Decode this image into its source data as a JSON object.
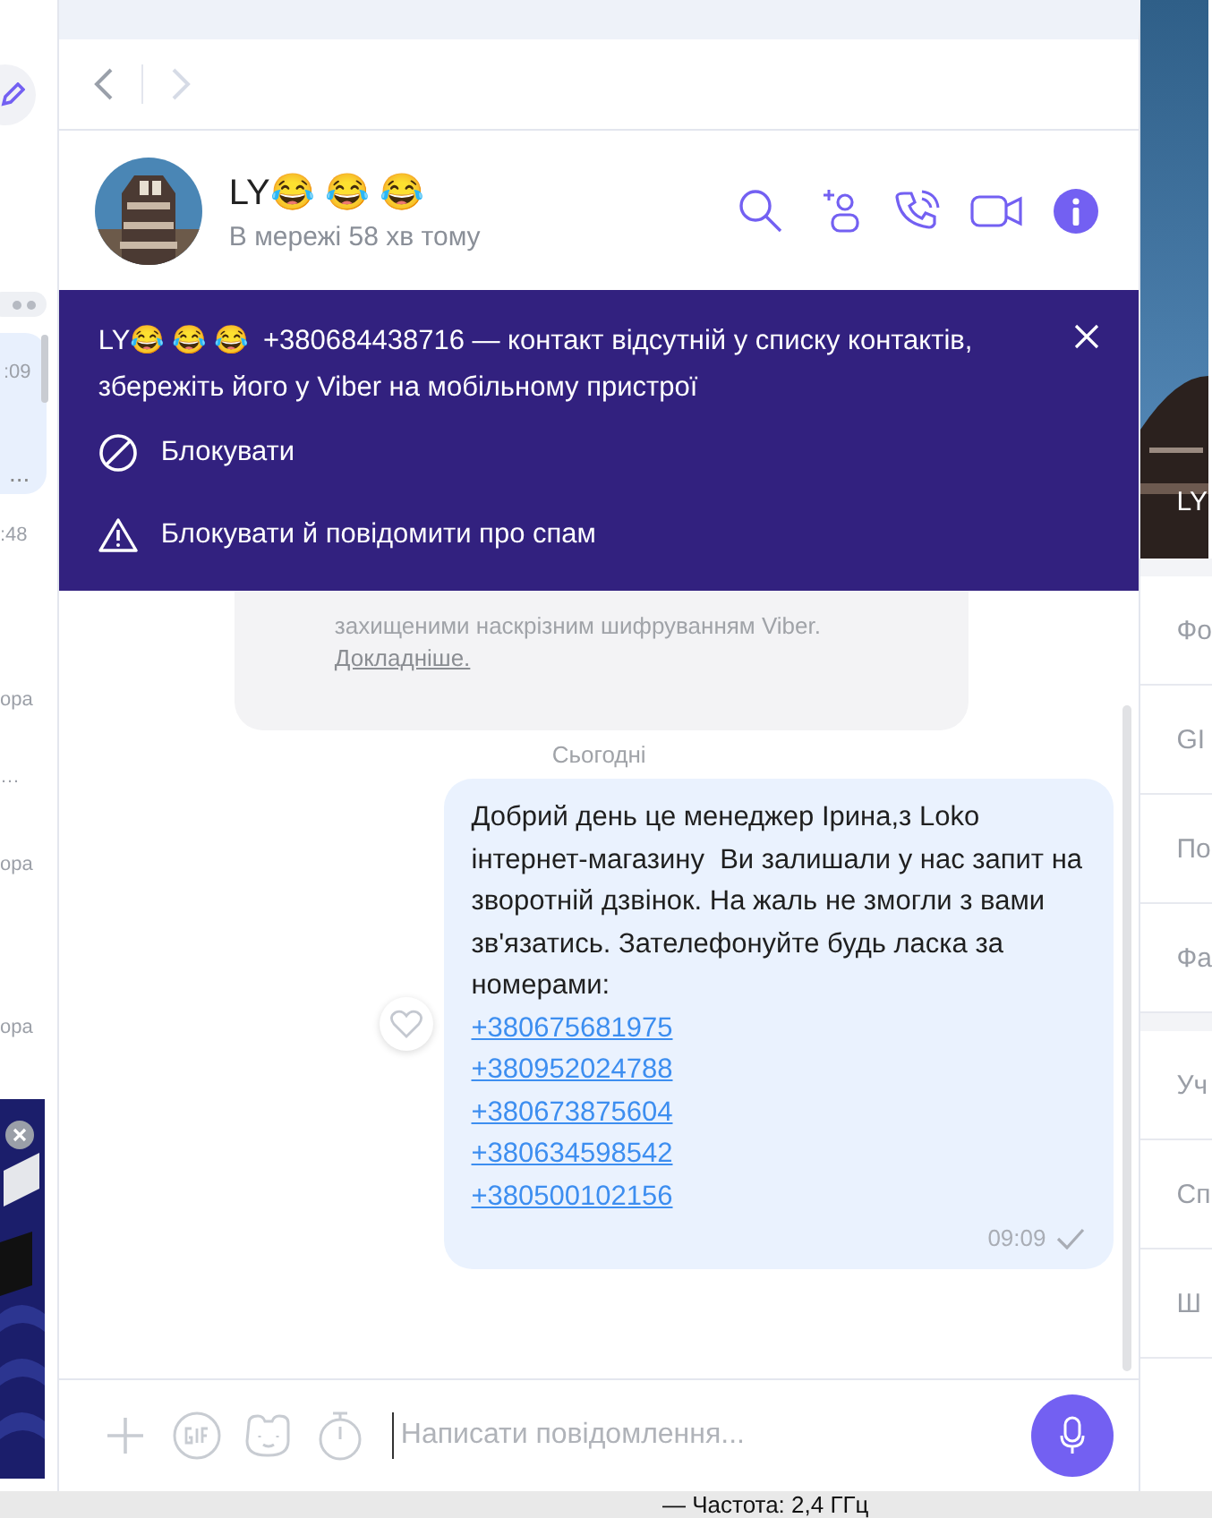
{
  "sidebar": {
    "chat": {
      "time": ":09",
      "preview": "...",
      "selected": true
    },
    "fragments": [
      ":48",
      "ора",
      "…",
      "ора",
      "ора"
    ]
  },
  "nav": {
    "back_disabled": false,
    "forward_disabled": true
  },
  "contact": {
    "name": "LY😂 😂 😂",
    "status": "В мережі 58 хв тому"
  },
  "banner": {
    "message": "LY😂 😂 😂  +380684438716 — контакт відсутній у списку контактів, збережіть його у Viber на мобільному пристрої",
    "actions": [
      {
        "kind": "block",
        "label": "Блокувати"
      },
      {
        "kind": "report",
        "label": "Блокувати й повідомити про спам"
      }
    ]
  },
  "notice": {
    "text": "захищеними наскрізним шифруванням Viber.",
    "link": "Докладніше."
  },
  "date": "Сьогодні",
  "message": {
    "text": "Добрий день це менеджер Ірина,з Loko інтернет-магазину  Ви залишали у нас запит на зворотній дзвінок. На жаль не змогли з вами зв'язатись. Зателефонуйте будь ласка за номерами:",
    "links": [
      "+380675681975",
      "+380952024788",
      "+380673875604",
      "+380634598542",
      "+380500102156"
    ],
    "time": "09:09",
    "delivered": true
  },
  "composer": {
    "placeholder": "Написати повідомлення..."
  },
  "info_panel": {
    "title": "LY",
    "items": [
      "Фо",
      "GI",
      "По",
      "Фа",
      "Уч",
      "Сп",
      "Ш"
    ]
  },
  "desktop_text": "—  Частота: 2,4 ГГц"
}
